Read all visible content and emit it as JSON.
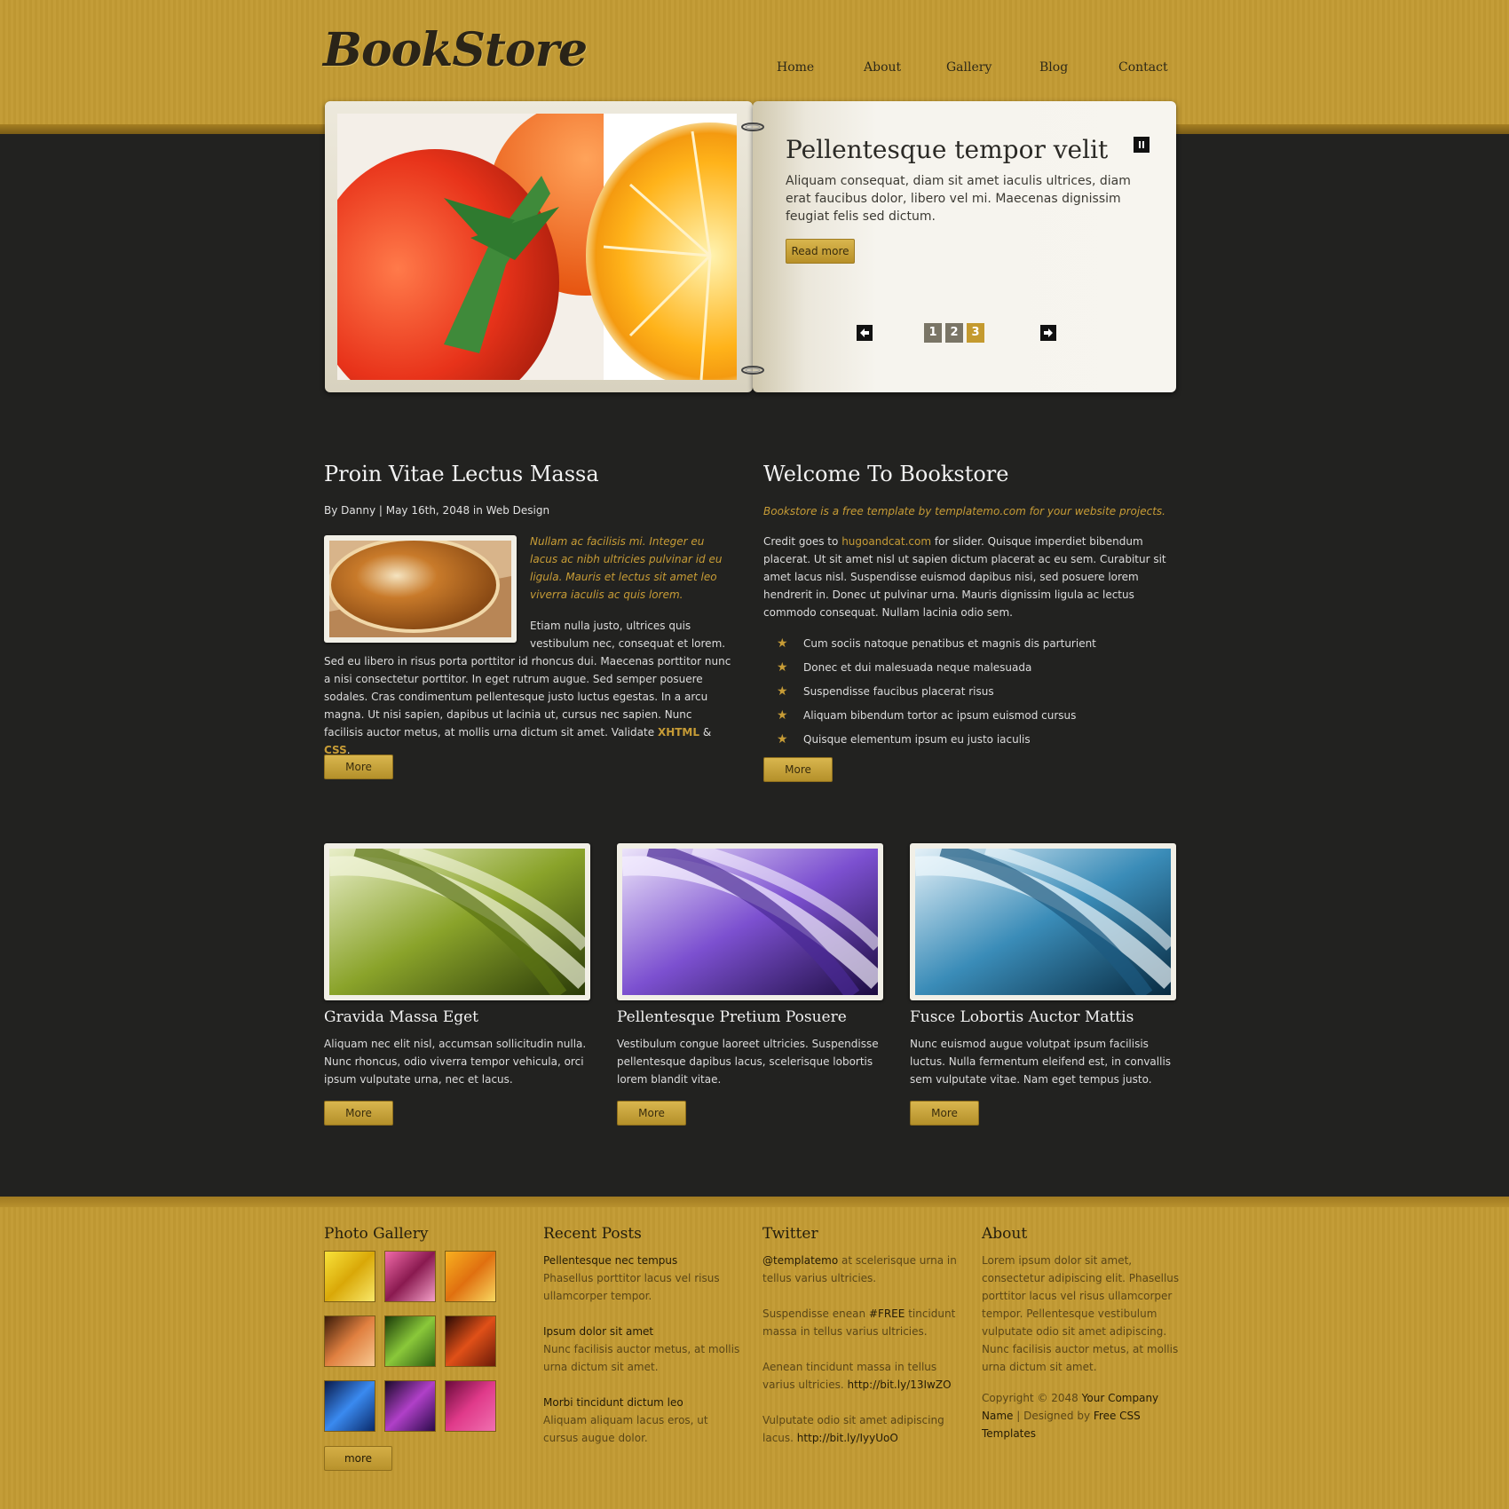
{
  "header": {
    "logo": "BookStore",
    "nav": [
      "Home",
      "About",
      "Gallery",
      "Blog",
      "Contact"
    ]
  },
  "slider": {
    "title": "Pellentesque tempor velit",
    "text": "Aliquam consequat, diam sit amet iaculis ultrices, diam erat faucibus dolor, libero vel mi. Maecenas dignissim feugiat felis sed dictum.",
    "read_more": "Read more",
    "pages": [
      "1",
      "2",
      "3"
    ],
    "active_page": "3"
  },
  "post": {
    "title": "Proin Vitae Lectus Massa",
    "meta": "By Danny | May 16th, 2048 in Web Design",
    "intro": "Nullam ac facilisis mi. Integer eu lacus ac nibh ultricies pulvinar id eu ligula. Mauris et lectus sit amet leo viverra iaculis ac quis lorem.",
    "body_side": "Etiam nulla justo, ultrices quis vestibulum nec, consequat et lorem.",
    "body": "Sed eu libero in risus porta porttitor id rhoncus dui. Maecenas porttitor nunc a nisi consectetur porttitor. In eget rutrum augue. Sed semper posuere sodales. Cras condimentum pellentesque justo luctus egestas. In a arcu magna. Ut nisi sapien, dapibus ut lacinia ut, cursus nec sapien. Nunc facilisis auctor metus, at mollis urna dictum sit amet. Validate",
    "link_xhtml": "XHTML",
    "amp": "&",
    "link_css": "CSS",
    "period": ".",
    "more": "More"
  },
  "welcome": {
    "title": "Welcome To Bookstore",
    "tagline": "Bookstore is a free template by templatemo.com for your website projects.",
    "credit_prefix": "Credit goes to",
    "credit_link": "hugoandcat.com",
    "credit_text": "for slider. Quisque imperdiet bibendum placerat. Ut sit amet nisl ut sapien dictum placerat ac eu sem. Curabitur sit amet lacus nisl. Suspendisse euismod dapibus nisi, sed posuere lorem hendrerit in. Donec ut pulvinar urna. Mauris dignissim ligula ac lectus commodo consequat. Nullam lacinia odio sem.",
    "list": [
      "Cum sociis natoque penatibus et magnis dis parturient",
      "Donec et dui malesuada neque malesuada",
      "Suspendisse faucibus placerat risus",
      "Aliquam bibendum tortor ac ipsum euismod cursus",
      "Quisque elementum ipsum eu justo iaculis"
    ],
    "more": "More"
  },
  "features": [
    {
      "title": "Gravida Massa Eget",
      "text": "Aliquam nec elit nisl, accumsan sollicitudin nulla. Nunc rhoncus, odio viverra tempor vehicula, orci ipsum vulputate urna, nec et lacus.",
      "more": "More",
      "color": "#7e9a22"
    },
    {
      "title": "Pellentesque Pretium Posuere",
      "text": "Vestibulum congue laoreet ultricies. Suspendisse pellentesque dapibus lacus, scelerisque lobortis lorem blandit vitae.",
      "more": "More",
      "color": "#7a4cc8"
    },
    {
      "title": "Fusce Lobortis Auctor Mattis",
      "text": "Nunc euismod augue volutpat ipsum facilisis luctus. Nulla fermentum eleifend est, in convallis sem vulputate vitae. Nam eget tempus justo.",
      "more": "More",
      "color": "#2f7fa8"
    }
  ],
  "footer": {
    "gallery": {
      "title": "Photo Gallery",
      "more": "more"
    },
    "recent": {
      "title": "Recent Posts",
      "items": [
        {
          "title": "Pellentesque nec tempus",
          "text": "Phasellus porttitor lacus vel risus ullamcorper tempor."
        },
        {
          "title": "Ipsum dolor sit amet",
          "text": "Nunc facilisis auctor metus, at mollis urna dictum sit amet."
        },
        {
          "title": "Morbi tincidunt dictum leo",
          "text": "Aliquam aliquam lacus eros, ut cursus augue dolor."
        }
      ]
    },
    "twitter": {
      "title": "Twitter",
      "t1_handle": "@templatemo",
      "t1_text": "at scelerisque urna in tellus varius ultricies.",
      "t2_pre": "Suspendisse enean",
      "t2_tag": "#FREE",
      "t2_post": "tincidunt massa in tellus varius ultricies.",
      "t3_text": "Aenean tincidunt massa in tellus varius ultricies.",
      "t3_link": "http://bit.ly/13IwZO",
      "t4_text": "Vulputate odio sit amet adipiscing lacus.",
      "t4_link": "http://bit.ly/IyyUoO"
    },
    "about": {
      "title": "About",
      "text": "Lorem ipsum dolor sit amet, consectetur adipiscing elit. Phasellus porttitor lacus vel risus ullamcorper tempor. Pellentesque vestibulum vulputate odio sit amet adipiscing. Nunc facilisis auctor metus, at mollis urna dictum sit amet.",
      "copy_pre": "Copyright © 2048",
      "company": "Your Company Name",
      "sep": "| Designed by",
      "designer": "Free CSS Templates"
    }
  }
}
